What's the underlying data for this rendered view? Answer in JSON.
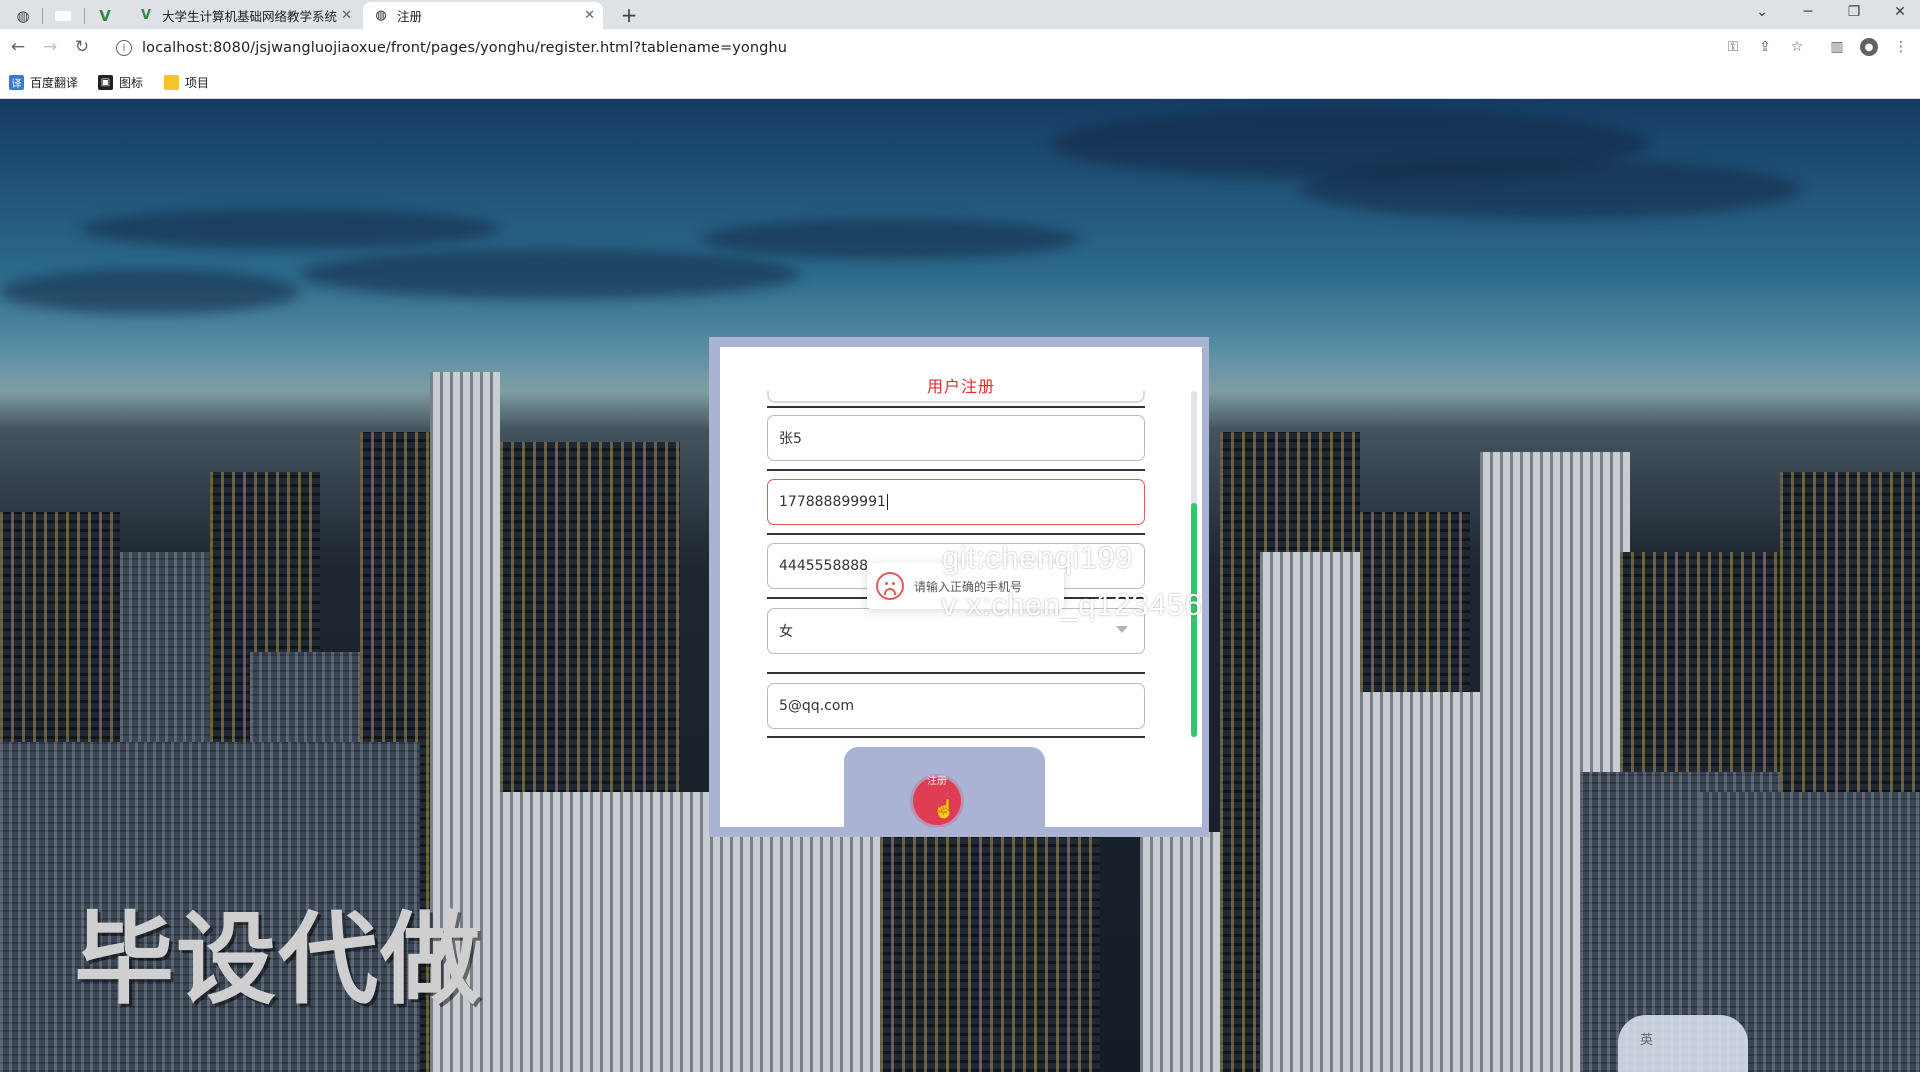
{
  "browser": {
    "tabs": [
      {
        "label": "大学生计算机基础网络教学系统",
        "active": false
      },
      {
        "label": "注册",
        "active": true
      }
    ],
    "url": "localhost:8080/jsjwangluojiaoxue/front/pages/yonghu/register.html?tablename=yonghu",
    "bookmarks": [
      {
        "label": "百度翻译"
      },
      {
        "label": "图标"
      },
      {
        "label": "项目"
      }
    ]
  },
  "form": {
    "title": "用户注册",
    "name_value": "张5",
    "phone_value": "177888899991",
    "idcard_value": "4445558888",
    "gender_value": "女",
    "email_value": "5@qq.com",
    "submit_label": "注册"
  },
  "toast": {
    "message": "请输入正确的手机号"
  },
  "overlay": {
    "watermark_git": "git:chenqi199",
    "watermark_vx": "v x:chen_q123456",
    "watermark_big": "毕设代做",
    "ime_label": "英"
  },
  "colors": {
    "title_red": "#e02d2d",
    "error_red": "#e25a5a",
    "card_frame": "#aab3d4",
    "scroll_green": "#35c36b"
  }
}
